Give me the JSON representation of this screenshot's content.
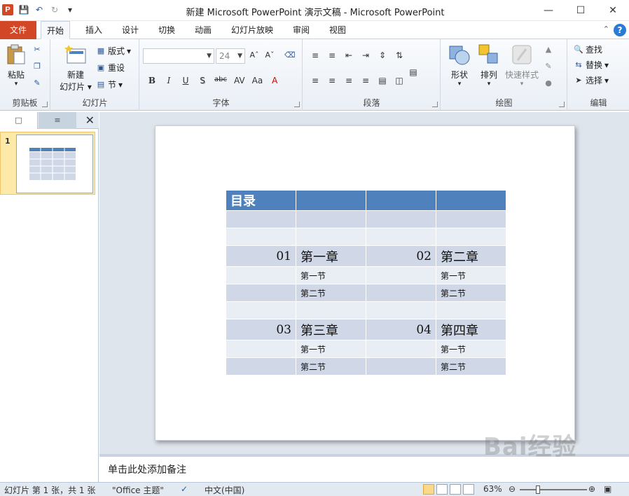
{
  "window": {
    "title": "新建 Microsoft PowerPoint 演示文稿 - Microsoft PowerPoint",
    "app_icon_letter": "P"
  },
  "tabs": [
    "文件",
    "开始",
    "插入",
    "设计",
    "切换",
    "动画",
    "幻灯片放映",
    "审阅",
    "视图"
  ],
  "ribbon": {
    "clipboard": {
      "label": "剪贴板",
      "paste": "粘贴"
    },
    "slides": {
      "label": "幻灯片",
      "new_slide_line1": "新建",
      "new_slide_line2": "幻灯片",
      "layout": "版式",
      "reset": "重设",
      "section": "节"
    },
    "font": {
      "label": "字体",
      "font_name": "",
      "font_size": "24",
      "bold": "B",
      "italic": "I",
      "underline": "U",
      "strike": "S",
      "shadow": "abc"
    },
    "paragraph": {
      "label": "段落"
    },
    "drawing": {
      "label": "绘图",
      "shapes": "形状",
      "arrange": "排列",
      "quick_styles": "快速样式"
    },
    "editing": {
      "label": "编辑",
      "find": "查找",
      "replace": "替换",
      "select": "选择"
    }
  },
  "slide_panel": {
    "thumbnail_number": "1"
  },
  "slide_table": {
    "header": "目录",
    "rows": [
      {
        "type": "chapter",
        "num_left": "01",
        "title_left": "第一章",
        "num_right": "02",
        "title_right": "第二章"
      },
      {
        "type": "section",
        "left": "第一节",
        "right": "第一节"
      },
      {
        "type": "section",
        "left": "第二节",
        "right": "第二节"
      },
      {
        "type": "chapter",
        "num_left": "03",
        "title_left": "第三章",
        "num_right": "04",
        "title_right": "第四章"
      },
      {
        "type": "section",
        "left": "第一节",
        "right": "第一节"
      },
      {
        "type": "section",
        "left": "第二节",
        "right": "第二节"
      }
    ]
  },
  "notes": {
    "placeholder": "单击此处添加备注"
  },
  "statusbar": {
    "slide_info": "幻灯片 第 1 张，共 1 张",
    "theme": "\"Office 主题\"",
    "language": "中文(中国)",
    "zoom": "63%"
  },
  "watermark": {
    "text": "Bai经验"
  },
  "colors": {
    "accent": "#d24726",
    "table_header": "#4f81bd",
    "table_band1": "#d0d8e8",
    "table_band2": "#e9edf4"
  }
}
